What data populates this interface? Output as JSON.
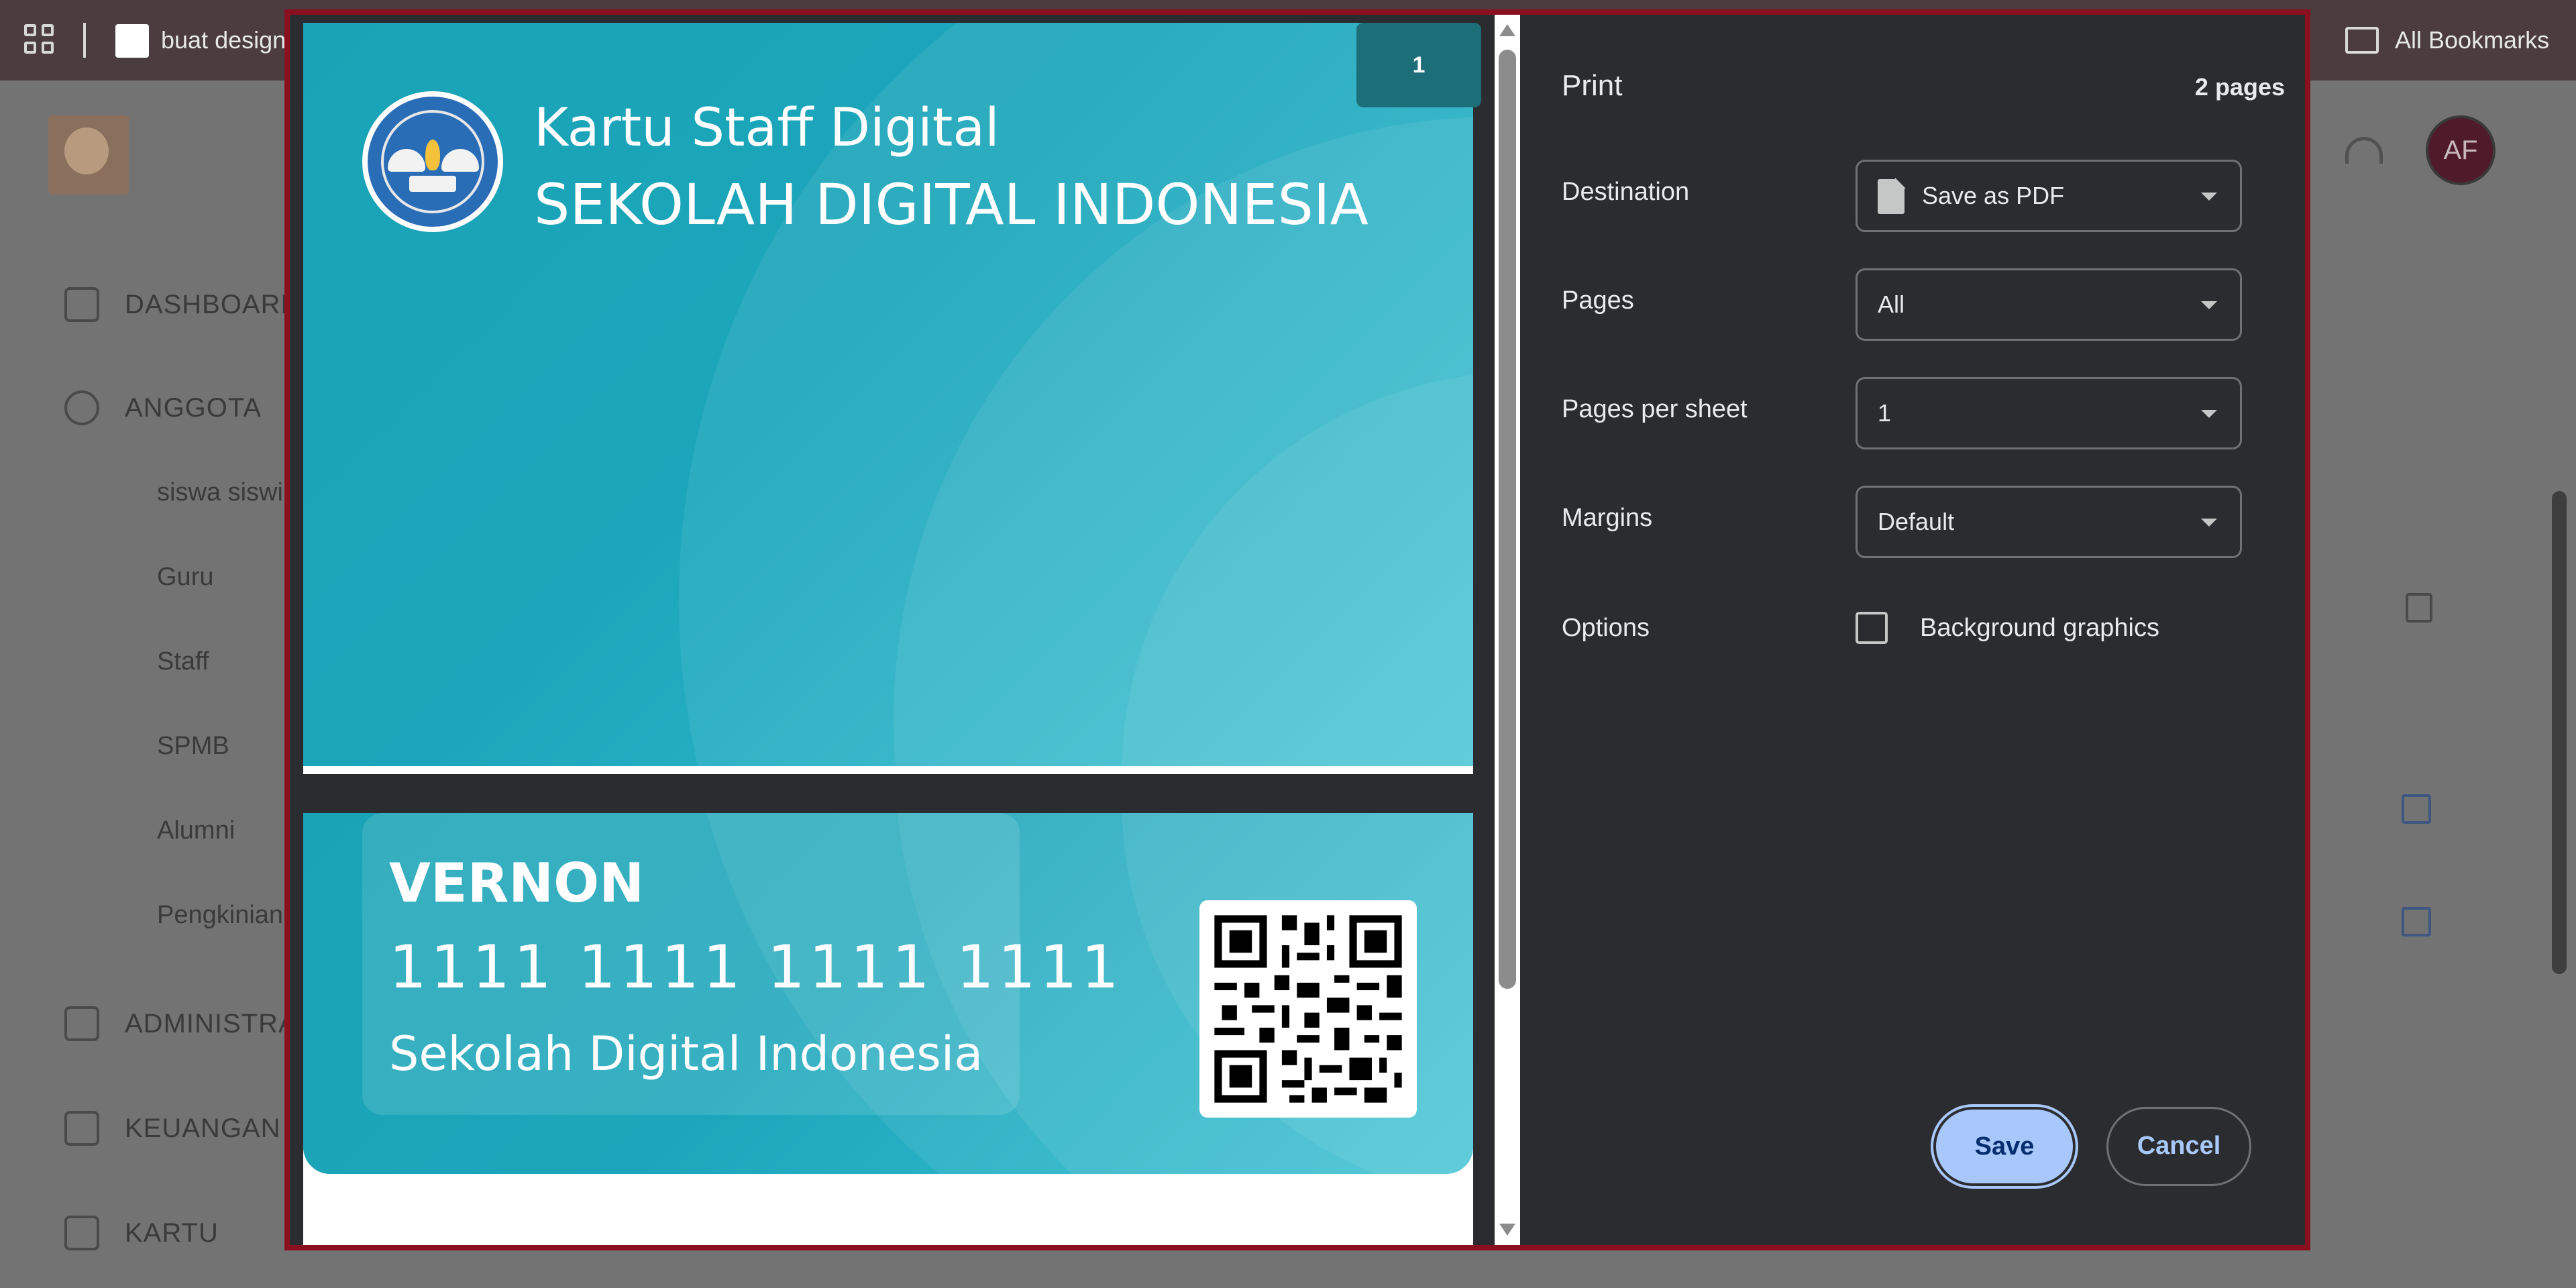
{
  "browser": {
    "tab_title": "buat design",
    "bookmarks_label": "All Bookmarks"
  },
  "sidebar": {
    "items": [
      {
        "label": "DASHBOARD"
      },
      {
        "label": "ANGGOTA"
      },
      {
        "label": "ADMINISTRASI"
      },
      {
        "label": "KEUANGAN"
      },
      {
        "label": "KARTU"
      }
    ],
    "subitems": [
      {
        "label": "siswa siswi"
      },
      {
        "label": "Guru"
      },
      {
        "label": "Staff"
      },
      {
        "label": "SPMB"
      },
      {
        "label": "Alumni"
      },
      {
        "label": "Pengkinian"
      }
    ]
  },
  "header": {
    "user_initials": "AF"
  },
  "preview": {
    "page_badge": "1",
    "card_front": {
      "title": "Kartu Staff Digital",
      "school": "SEKOLAH DIGITAL INDONESIA"
    },
    "card_back": {
      "name": "VERNON",
      "number": "1111 1111 1111 1111",
      "school": "Sekolah Digital Indonesia"
    }
  },
  "print": {
    "title": "Print",
    "page_count": "2 pages",
    "rows": {
      "destination": {
        "label": "Destination",
        "value": "Save as PDF"
      },
      "pages": {
        "label": "Pages",
        "value": "All"
      },
      "pages_per_sheet": {
        "label": "Pages per sheet",
        "value": "1"
      },
      "margins": {
        "label": "Margins",
        "value": "Default"
      },
      "options": {
        "label": "Options",
        "checkbox_label": "Background graphics",
        "checked": false
      }
    },
    "save_label": "Save",
    "cancel_label": "Cancel"
  },
  "colors": {
    "dialog_border": "#8a1020",
    "card_teal": "#1aa3b6",
    "save_button": "#a8c7fa"
  }
}
